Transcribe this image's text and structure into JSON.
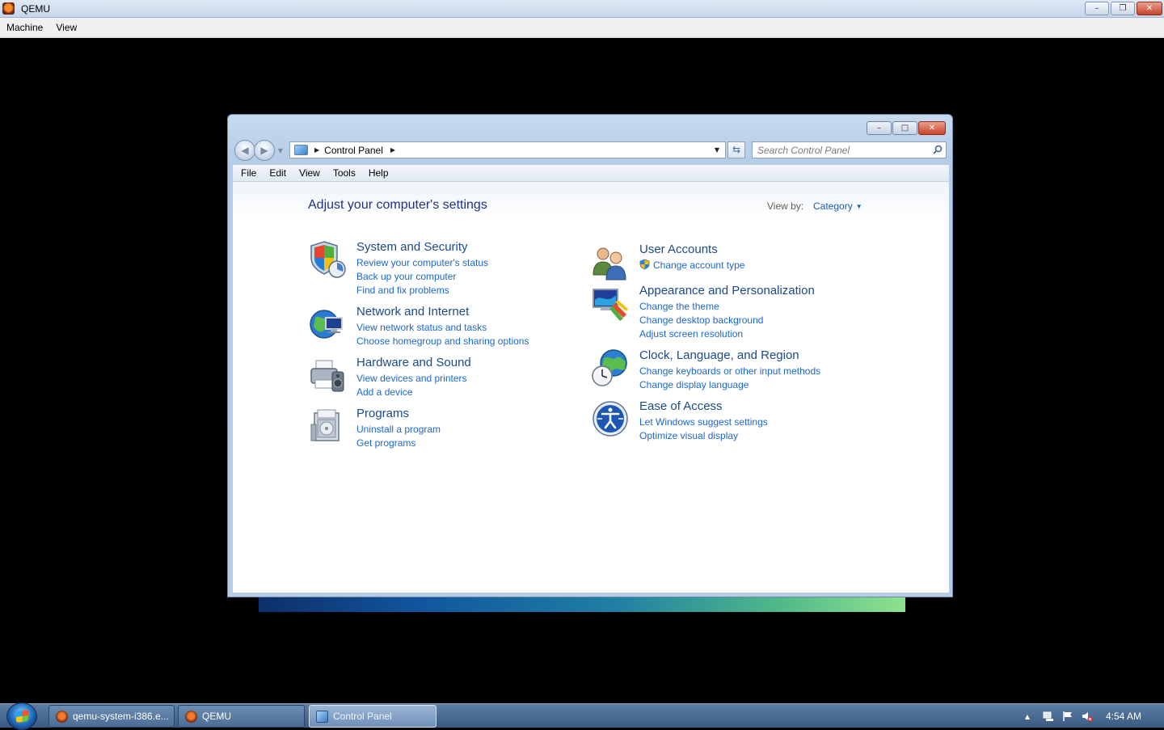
{
  "host": {
    "title": "QEMU",
    "menu": [
      "Machine",
      "View"
    ]
  },
  "window": {
    "address": {
      "crumb": "Control Panel"
    },
    "search": {
      "placeholder": "Search Control Panel"
    },
    "menu": [
      "File",
      "Edit",
      "View",
      "Tools",
      "Help"
    ]
  },
  "content": {
    "heading": "Adjust your computer's settings",
    "view_by_label": "View by:",
    "view_by_value": "Category",
    "left_categories": [
      {
        "title": "System and Security",
        "icon": "shield-icon",
        "links": [
          "Review your computer's status",
          "Back up your computer",
          "Find and fix problems"
        ]
      },
      {
        "title": "Network and Internet",
        "icon": "network-globe-icon",
        "links": [
          "View network status and tasks",
          "Choose homegroup and sharing options"
        ]
      },
      {
        "title": "Hardware and Sound",
        "icon": "printer-speaker-icon",
        "links": [
          "View devices and printers",
          "Add a device"
        ]
      },
      {
        "title": "Programs",
        "icon": "programs-box-icon",
        "links": [
          "Uninstall a program",
          "Get programs"
        ]
      }
    ],
    "right_categories": [
      {
        "title": "User Accounts",
        "icon": "users-icon",
        "links": [
          "Change account type"
        ]
      },
      {
        "title": "Appearance and Personalization",
        "icon": "monitor-paint-icon",
        "links": [
          "Change the theme",
          "Change desktop background",
          "Adjust screen resolution"
        ]
      },
      {
        "title": "Clock, Language, and Region",
        "icon": "clock-globe-icon",
        "links": [
          "Change keyboards or other input methods",
          "Change display language"
        ]
      },
      {
        "title": "Ease of Access",
        "icon": "ease-of-access-icon",
        "links": [
          "Let Windows suggest settings",
          "Optimize visual display"
        ]
      }
    ]
  },
  "taskbar": {
    "buttons": [
      "qemu-system-i386.e...",
      "QEMU",
      "Control Panel"
    ],
    "clock": "4:54 AM"
  },
  "colors": {
    "heading": "#1e3287",
    "category_title": "#1b4a8a",
    "link": "#1c67cf"
  }
}
